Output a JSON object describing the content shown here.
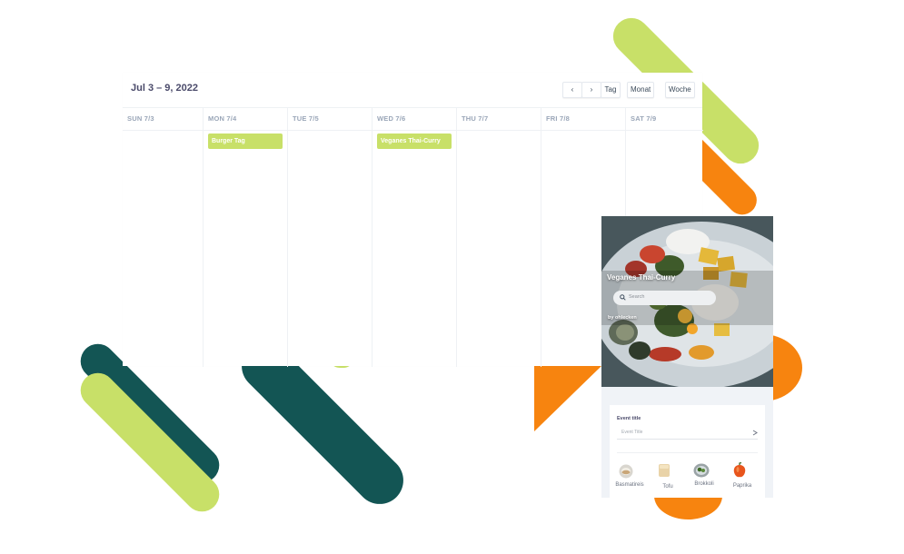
{
  "calendar": {
    "title": "Jul 3 – 9, 2022",
    "nav": {
      "prev": "‹",
      "next": "›",
      "day": "Tag",
      "month": "Monat",
      "week": "Woche"
    },
    "days": [
      {
        "label": "SUN 7/3",
        "events": []
      },
      {
        "label": "MON 7/4",
        "events": [
          "Burger Tag"
        ]
      },
      {
        "label": "TUE 7/5",
        "events": []
      },
      {
        "label": "WED 7/6",
        "events": [
          "Veganes Thai-Curry"
        ]
      },
      {
        "label": "THU 7/7",
        "events": []
      },
      {
        "label": "FRI 7/8",
        "events": []
      },
      {
        "label": "SAT 7/9",
        "events": []
      }
    ],
    "colors": {
      "event": "#c8e068",
      "header_text": "#4a4a6a",
      "day_text": "#9aa6b8"
    }
  },
  "phone": {
    "hero_title": "Veganes Thai-Curry",
    "search_placeholder": "Search",
    "author": "by ohlecken",
    "form": {
      "label": "Event title",
      "placeholder": "Event Title"
    },
    "ingredients": [
      {
        "name": "Basmatireis",
        "icon": "rice-bowl-icon"
      },
      {
        "name": "Tofu",
        "icon": "tofu-icon"
      },
      {
        "name": "Brokkoli",
        "icon": "broccoli-icon"
      },
      {
        "name": "Paprika",
        "icon": "bell-pepper-icon"
      }
    ]
  },
  "decor_colors": {
    "lime": "#c8e068",
    "dark_teal": "#135554",
    "orange": "#f7840f"
  }
}
